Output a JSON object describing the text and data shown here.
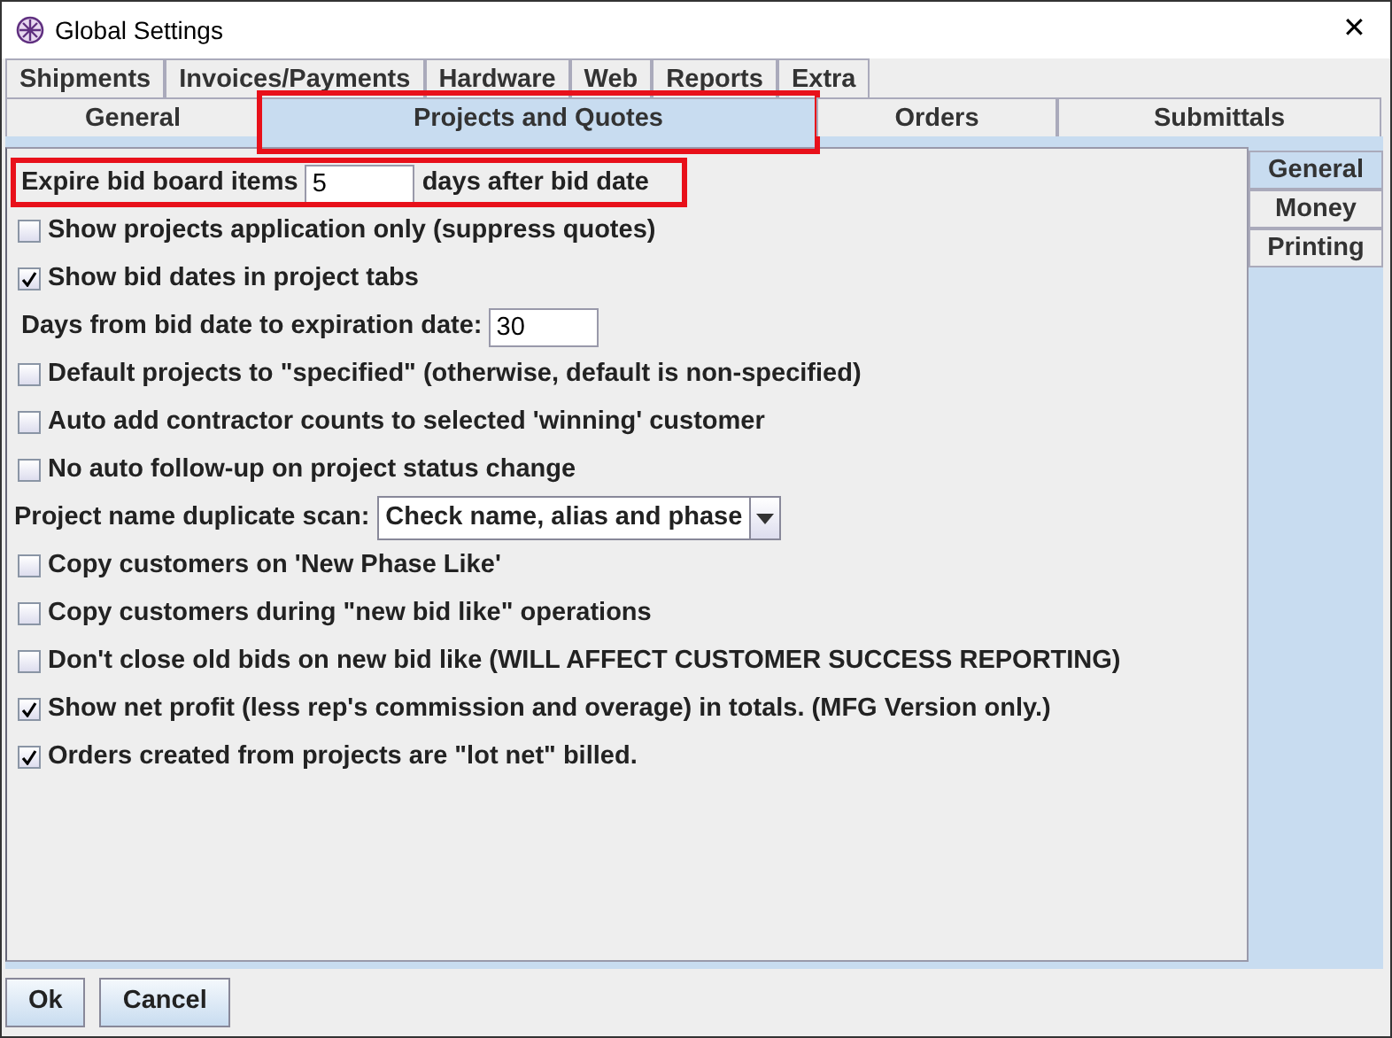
{
  "window": {
    "title": "Global Settings",
    "close": "✕"
  },
  "tab_rows": [
    [
      {
        "label": "Shipments",
        "selected": false,
        "highlighted": false
      },
      {
        "label": "Invoices/Payments",
        "selected": false,
        "highlighted": false
      },
      {
        "label": "Hardware",
        "selected": false,
        "highlighted": false
      },
      {
        "label": "Web",
        "selected": false,
        "highlighted": false
      },
      {
        "label": "Reports",
        "selected": false,
        "highlighted": false
      },
      {
        "label": "Extra",
        "selected": false,
        "highlighted": false
      }
    ],
    [
      {
        "label": "General",
        "selected": false,
        "highlighted": false
      },
      {
        "label": "Projects and Quotes",
        "selected": true,
        "highlighted": true
      },
      {
        "label": "Orders",
        "selected": false,
        "highlighted": false
      },
      {
        "label": "Submittals",
        "selected": false,
        "highlighted": false
      }
    ]
  ],
  "side_tabs": [
    {
      "label": "General",
      "selected": true
    },
    {
      "label": "Money",
      "selected": false
    },
    {
      "label": "Printing",
      "selected": false
    }
  ],
  "settings": [
    {
      "kind": "field",
      "label": "Expire bid board items",
      "value": "5",
      "suffix": "days after bid date",
      "highlighted": true
    },
    {
      "kind": "checkbox",
      "label": "Show projects application only (suppress quotes)",
      "checked": false
    },
    {
      "kind": "checkbox",
      "label": "Show bid dates in project tabs",
      "checked": true
    },
    {
      "kind": "field",
      "label": "Days from bid date to expiration date:",
      "value": "30",
      "highlighted": false
    },
    {
      "kind": "checkbox",
      "label": "Default projects to \"specified\" (otherwise, default is non-specified)",
      "checked": false
    },
    {
      "kind": "checkbox",
      "label": "Auto add contractor counts to selected 'winning' customer",
      "checked": false
    },
    {
      "kind": "checkbox",
      "label": "No auto follow-up on project status change",
      "checked": false
    },
    {
      "kind": "dropdown",
      "label": "Project name duplicate scan:",
      "value": "Check name, alias and phase"
    },
    {
      "kind": "checkbox",
      "label": "Copy customers on 'New Phase Like'",
      "checked": false
    },
    {
      "kind": "checkbox",
      "label": "Copy customers during \"new bid like\" operations",
      "checked": false
    },
    {
      "kind": "checkbox",
      "label": "Don't close old bids on new bid like (WILL AFFECT CUSTOMER SUCCESS REPORTING)",
      "checked": false
    },
    {
      "kind": "checkbox",
      "label": "Show net profit (less rep's commission and overage) in totals. (MFG Version only.)",
      "checked": true
    },
    {
      "kind": "checkbox",
      "label": "Orders created from projects are \"lot net\" billed.",
      "checked": true
    }
  ],
  "buttons": [
    "Ok",
    "Cancel"
  ]
}
